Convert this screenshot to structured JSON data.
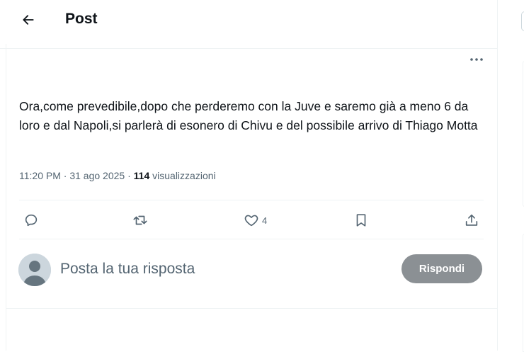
{
  "header": {
    "title": "Post"
  },
  "post": {
    "text": "Ora,come prevedibile,dopo che perderemo con la Juve e saremo già a meno 6 da loro e dal Napoli,si parlerà di esonero di Chivu e del possibile arrivo di Thiago Motta",
    "time": "11:20 PM",
    "date": "31 ago 2025",
    "views_count": "114",
    "views_label": "visualizzazioni"
  },
  "actions": {
    "reply_icon": "reply-icon",
    "repost_icon": "repost-icon",
    "like_icon": "heart-icon",
    "like_count": "4",
    "bookmark_icon": "bookmark-icon",
    "share_icon": "share-icon"
  },
  "reply_box": {
    "placeholder": "Posta la tua risposta",
    "button_label": "Rispondi"
  },
  "colors": {
    "text": "#0f1419",
    "secondary": "#536471",
    "button_disabled": "#8b9094",
    "divider": "#eff3f4"
  }
}
